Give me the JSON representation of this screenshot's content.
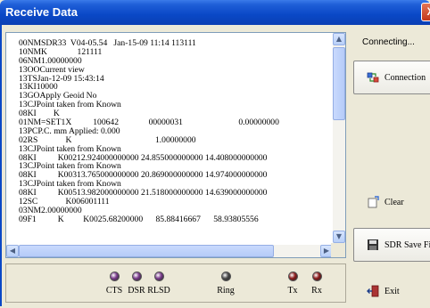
{
  "window": {
    "title": "Receive Data",
    "close_label": "X"
  },
  "received_text": {
    "lines": [
      "00NMSDR33  V04-05.54   Jan-15-09 11:14 113111",
      "10NMK              121111",
      "06NM1.00000000",
      "13OOCurrent view",
      "13TSJan-12-09 15:43:14",
      "13KI10000",
      "13GOApply Geoid No",
      "13CJPoint taken from Known",
      "08KI        K",
      "01NM=SET1X          100642              00000031                          0.00000000",
      "13PCP.C. mm Applied: 0.000",
      "02RS             K                                       1.00000000",
      "13CJPoint taken from Known",
      "08KI          K00212.924000000000 24.855000000000 14.408000000000",
      "13CJPoint taken from Known",
      "08KI          K00313.765000000000 20.869000000000 14.974000000000",
      "13CJPoint taken from Known",
      "08KI          K00513.982000000000 21.518000000000 14.639000000000",
      "12SC             K006001111",
      "03NM2.00000000",
      "09F1          K         K0025.68200000      85.88416667      58.93805556"
    ]
  },
  "status": {
    "text": "Connecting..."
  },
  "buttons": {
    "connection": "Connection",
    "clear": "Clear",
    "save": "SDR Save File",
    "exit": "Exit"
  },
  "signals": [
    {
      "label": "CTS",
      "color": "#7a3b8c"
    },
    {
      "label": "DSR",
      "color": "#7a3b8c"
    },
    {
      "label": "RLSD",
      "color": "#7a3b8c"
    },
    {
      "label": "Ring",
      "color": "#4a4a4a"
    },
    {
      "label": "Tx",
      "color": "#8b1a1a"
    },
    {
      "label": "Rx",
      "color": "#8b1a1a"
    }
  ]
}
